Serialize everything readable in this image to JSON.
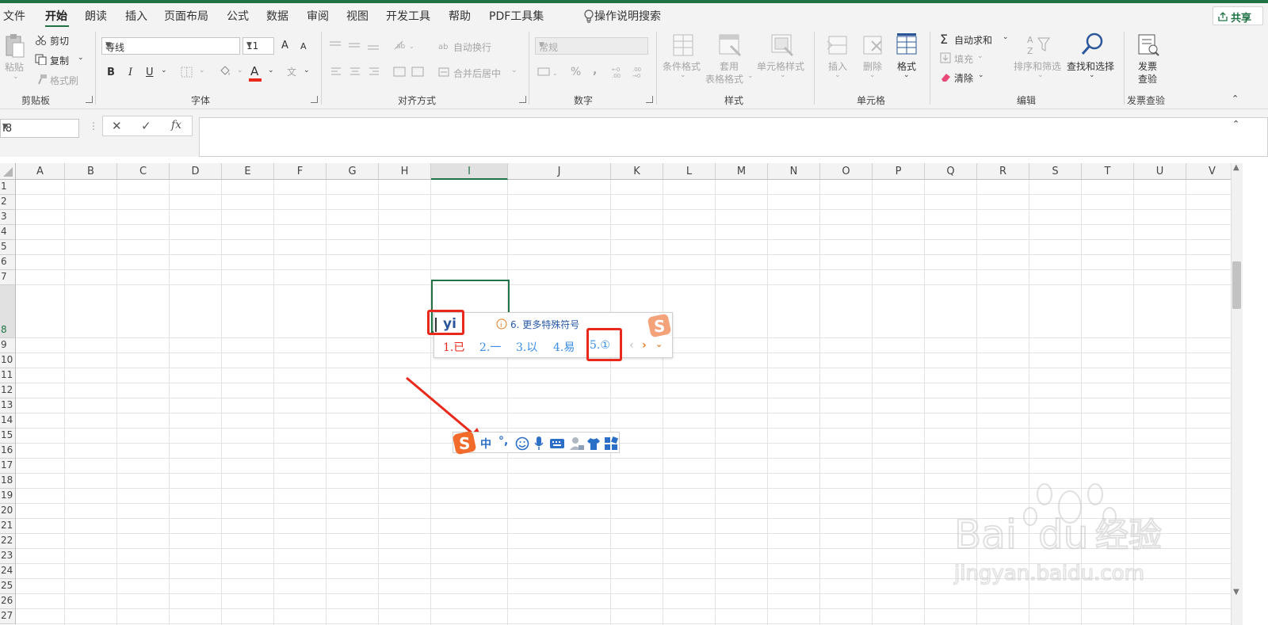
{
  "menu": {
    "tabs": [
      "文件",
      "开始",
      "朗读",
      "插入",
      "页面布局",
      "公式",
      "数据",
      "审阅",
      "视图",
      "开发工具",
      "帮助",
      "PDF工具集"
    ],
    "search": "操作说明搜索",
    "share": "共享"
  },
  "ribbon": {
    "clipboard": {
      "paste": "粘贴",
      "cut": "剪切",
      "copy": "复制",
      "format_painter": "格式刷",
      "label": "剪贴板"
    },
    "font": {
      "name": "等线",
      "size": "11",
      "grow": "A",
      "shrink": "A",
      "bold": "B",
      "italic": "I",
      "underline": "U",
      "color": "A",
      "phonetic": "文",
      "label": "字体"
    },
    "alignment": {
      "wrap": "自动换行",
      "merge": "合并后居中",
      "label": "对齐方式"
    },
    "number": {
      "format": "常规",
      "percent": "%",
      "comma": ",",
      "label": "数字"
    },
    "styles": {
      "conditional": "条件格式",
      "table1": "套用",
      "table2": "表格格式",
      "cell_styles": "单元格样式",
      "label": "样式"
    },
    "cells": {
      "insert": "插入",
      "delete": "删除",
      "format": "格式",
      "label": "单元格"
    },
    "editing": {
      "autosum": "自动求和",
      "fill": "填充",
      "clear": "清除",
      "sort": "排序和筛选",
      "find": "查找和选择",
      "label": "编辑"
    },
    "invoice": {
      "check1": "发票",
      "check2": "查验",
      "label": "发票查验"
    }
  },
  "formula_bar": {
    "name_box": "I8",
    "cancel": "✕",
    "enter": "✓",
    "fx": "fx",
    "value": ""
  },
  "sheet": {
    "columns": [
      "A",
      "B",
      "C",
      "D",
      "E",
      "F",
      "G",
      "H",
      "I",
      "J",
      "K",
      "L",
      "M",
      "N",
      "O",
      "P",
      "Q",
      "R",
      "S",
      "T",
      "U",
      "V"
    ],
    "rows": [
      "1",
      "2",
      "3",
      "4",
      "5",
      "6",
      "7",
      "8",
      "9",
      "10",
      "11",
      "12",
      "13",
      "14",
      "15",
      "16",
      "17",
      "18",
      "19",
      "20",
      "21",
      "22",
      "23",
      "24",
      "25",
      "26",
      "27"
    ],
    "selected_cell": "I8"
  },
  "ime": {
    "composition": "yi",
    "hint": "6. 更多特殊符号",
    "candidates": [
      "1.已",
      "2.一",
      "3.以",
      "4.易",
      "5.①"
    ],
    "status_mode": "中",
    "punct": "°,"
  },
  "colors": {
    "accent": "#217346",
    "highlight": "#e8291c",
    "ime_blue": "#3a8ee6",
    "sogou": "#f26b2a"
  },
  "watermark": {
    "brand": "Bai du 经验",
    "url": "jingyan.baidu.com"
  }
}
